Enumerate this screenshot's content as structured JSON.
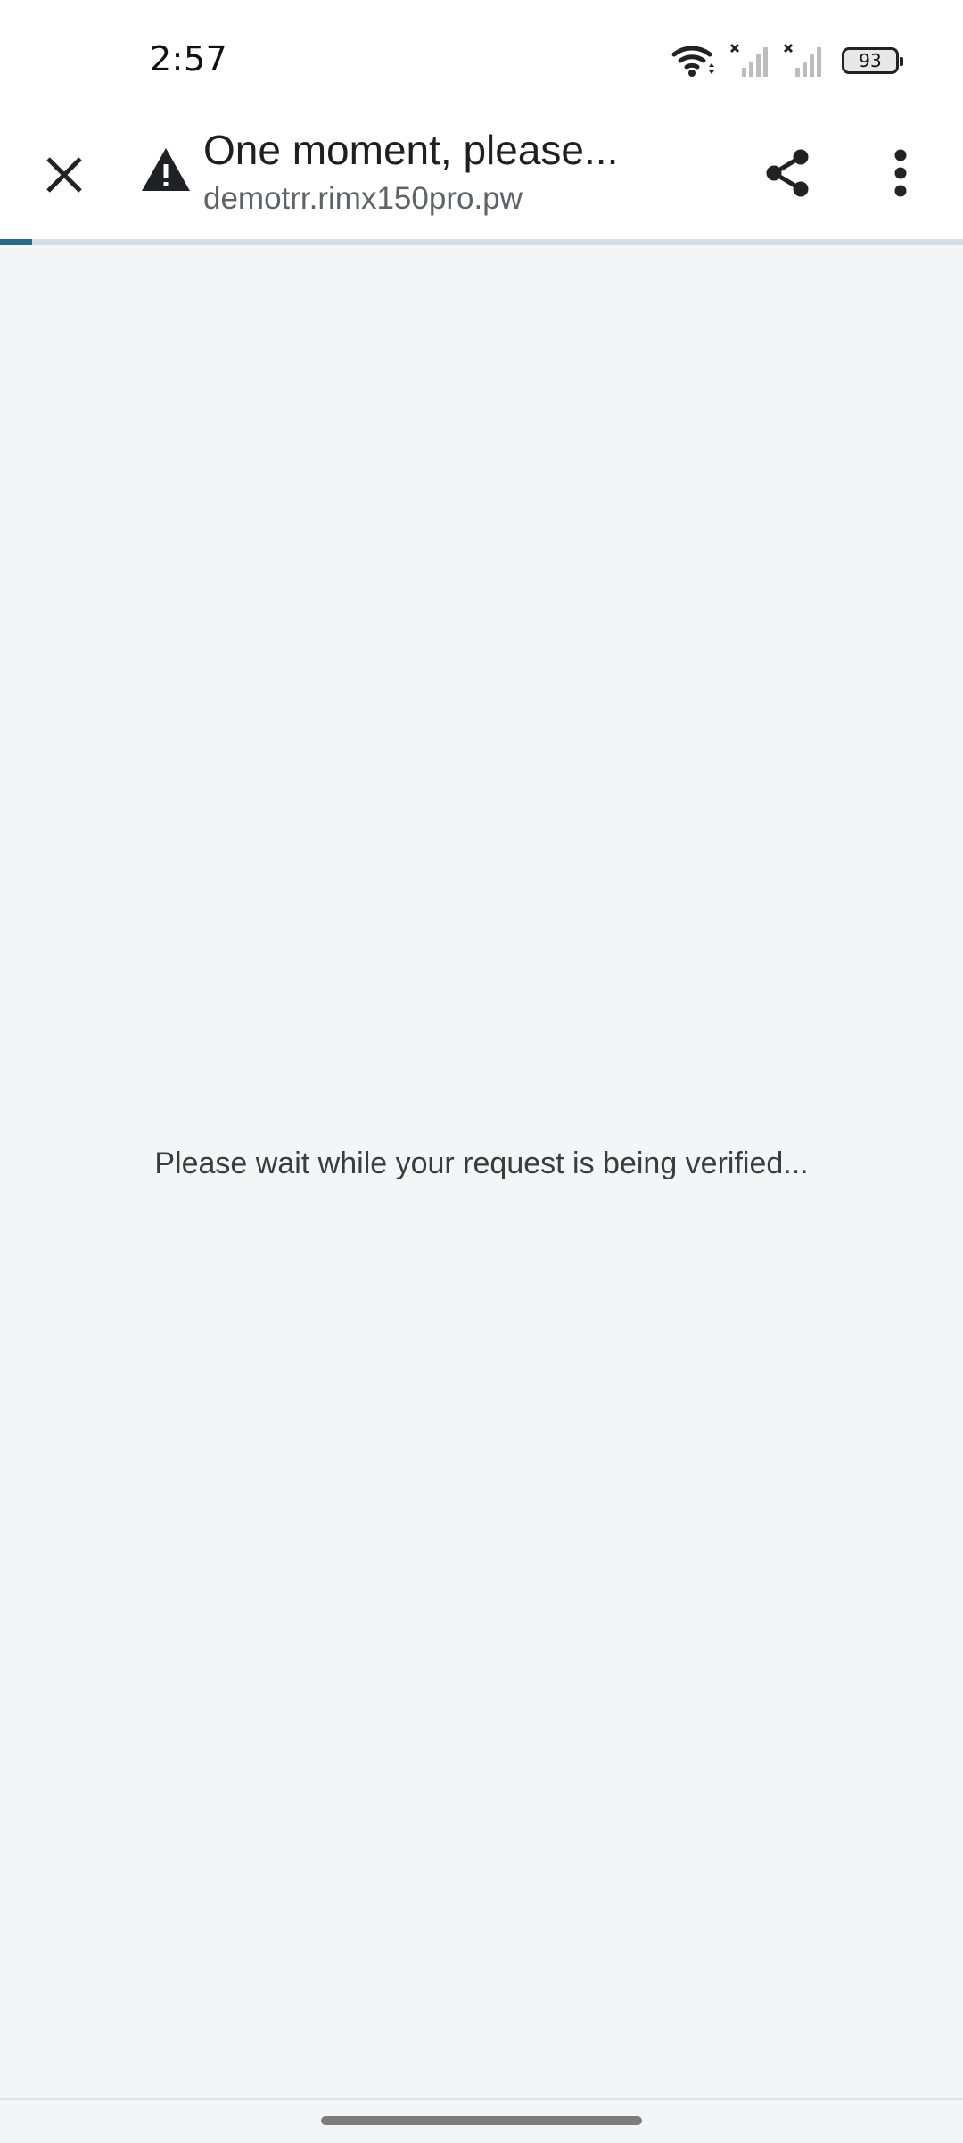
{
  "status_bar": {
    "time": "2:57",
    "battery_level": "93",
    "icons": [
      "wifi-icon",
      "signal-no-service-icon",
      "signal-no-service-icon",
      "battery-icon"
    ]
  },
  "toolbar": {
    "title": "One moment, please...",
    "url": "demotrr.rimx150pro.pw",
    "security_icon": "warning-icon",
    "close_icon": "close-icon",
    "share_icon": "share-icon",
    "menu_icon": "more-vert-icon"
  },
  "loading": {
    "progress_fraction": 0.033,
    "color": "#2a6a83"
  },
  "content": {
    "message": "Please wait while your request is being verified..."
  }
}
